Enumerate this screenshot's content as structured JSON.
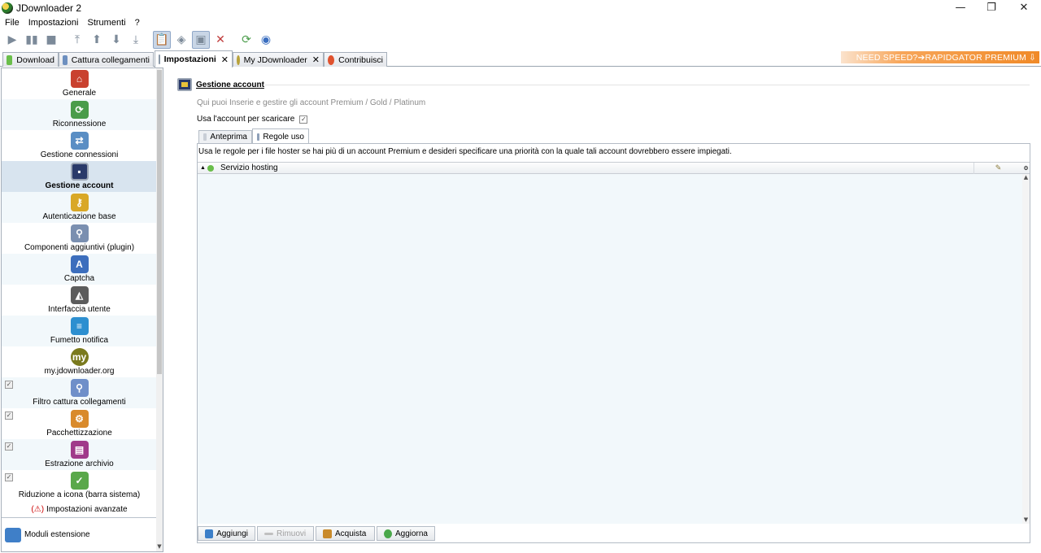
{
  "window": {
    "title": "JDownloader 2",
    "controls": {
      "minimize": "—",
      "restore": "❐",
      "close": "✕"
    }
  },
  "menu": [
    "File",
    "Impostazioni",
    "Strumenti",
    "?"
  ],
  "toolbar": {
    "icons": [
      "play-icon",
      "pause-icon",
      "stop-icon",
      "move-top-icon",
      "move-up-icon",
      "move-down-icon",
      "move-bottom-icon",
      "clipboard-icon",
      "premium-icon",
      "reconnect-toggle-icon",
      "shutdown-icon",
      "update-icon",
      "reconnect-icon"
    ]
  },
  "tabs": [
    {
      "label": "Download",
      "color": "#6abe4a"
    },
    {
      "label": "Cattura collegamenti",
      "color": "#6d8fbf"
    },
    {
      "label": "Impostazioni",
      "color": "#8a98a8",
      "active": true,
      "close": "✕"
    },
    {
      "label": "My JDownloader",
      "color": "#b8a23a",
      "close": "✕"
    },
    {
      "label": "Contribuisci",
      "color": "#e0522e"
    }
  ],
  "banner": {
    "text": "NEED SPEED?➔RAPIDGATOR PREMIUM"
  },
  "sidebar": {
    "items": [
      {
        "label": "Generale",
        "icon": "home-icon",
        "color": "#c9412f"
      },
      {
        "label": "Riconnessione",
        "icon": "reconnect-icon",
        "color": "#4a9c4a"
      },
      {
        "label": "Gestione connessioni",
        "icon": "network-icon",
        "color": "#5a8ec4"
      },
      {
        "label": "Gestione account",
        "icon": "monitor-icon",
        "color": "#2a3a6a",
        "active": true
      },
      {
        "label": "Autenticazione base",
        "icon": "keys-icon",
        "color": "#d9a826"
      },
      {
        "label": "Componenti aggiuntivi (plugin)",
        "icon": "plugin-search-icon",
        "color": "#7a8fb0"
      },
      {
        "label": "Captcha",
        "icon": "captcha-icon",
        "color": "#3c6ebd"
      },
      {
        "label": "Interfaccia utente",
        "icon": "ui-icon",
        "color": "#5c5c5c"
      },
      {
        "label": "Fumetto notifica",
        "icon": "speech-bubble-icon",
        "color": "#2d8fd0"
      },
      {
        "label": "my.jdownloader.org",
        "icon": "myjd-icon",
        "color": "#7a7a1e"
      },
      {
        "label": "Filtro cattura collegamenti",
        "icon": "filter-icon",
        "color": "#6f8fc9",
        "check": true
      },
      {
        "label": "Pacchettizzazione",
        "icon": "packager-icon",
        "color": "#d98a2b",
        "check": true
      },
      {
        "label": "Estrazione archivio",
        "icon": "archive-icon",
        "color": "#a03a8a",
        "check": true
      },
      {
        "label": "Riduzione a icona (barra sistema)",
        "icon": "tray-icon",
        "color": "#5aa84a",
        "check": true
      }
    ],
    "advanced": "Impostazioni avanzate",
    "extensions": "Moduli estensione"
  },
  "main": {
    "title": "Gestione account",
    "description": "Qui puoi Inserie e gestire gli account Premium / Gold / Platinum",
    "use_account_label": "Usa l'account per scaricare",
    "use_account_checked": true,
    "subtabs": [
      {
        "label": "Anteprima"
      },
      {
        "label": "Regole uso",
        "active": true
      }
    ],
    "rules_description": "Usa le regole per i file hoster se hai più di un account Premium e desideri specificare una priorità con la quale tali account dovrebbero essere impiegati.",
    "table": {
      "columns": [
        "Servizio hosting"
      ]
    },
    "buttons": [
      {
        "label": "Aggiungi",
        "icon": "plus-icon",
        "color": "#3c7fc8",
        "enabled": true
      },
      {
        "label": "Rimuovi",
        "icon": "minus-icon",
        "color": "#b0b0b0",
        "enabled": false
      },
      {
        "label": "Acquista",
        "icon": "buy-icon",
        "color": "#c98a2a",
        "enabled": true
      },
      {
        "label": "Aggiorna",
        "icon": "refresh-icon",
        "color": "#4aa84a",
        "enabled": true
      }
    ]
  }
}
